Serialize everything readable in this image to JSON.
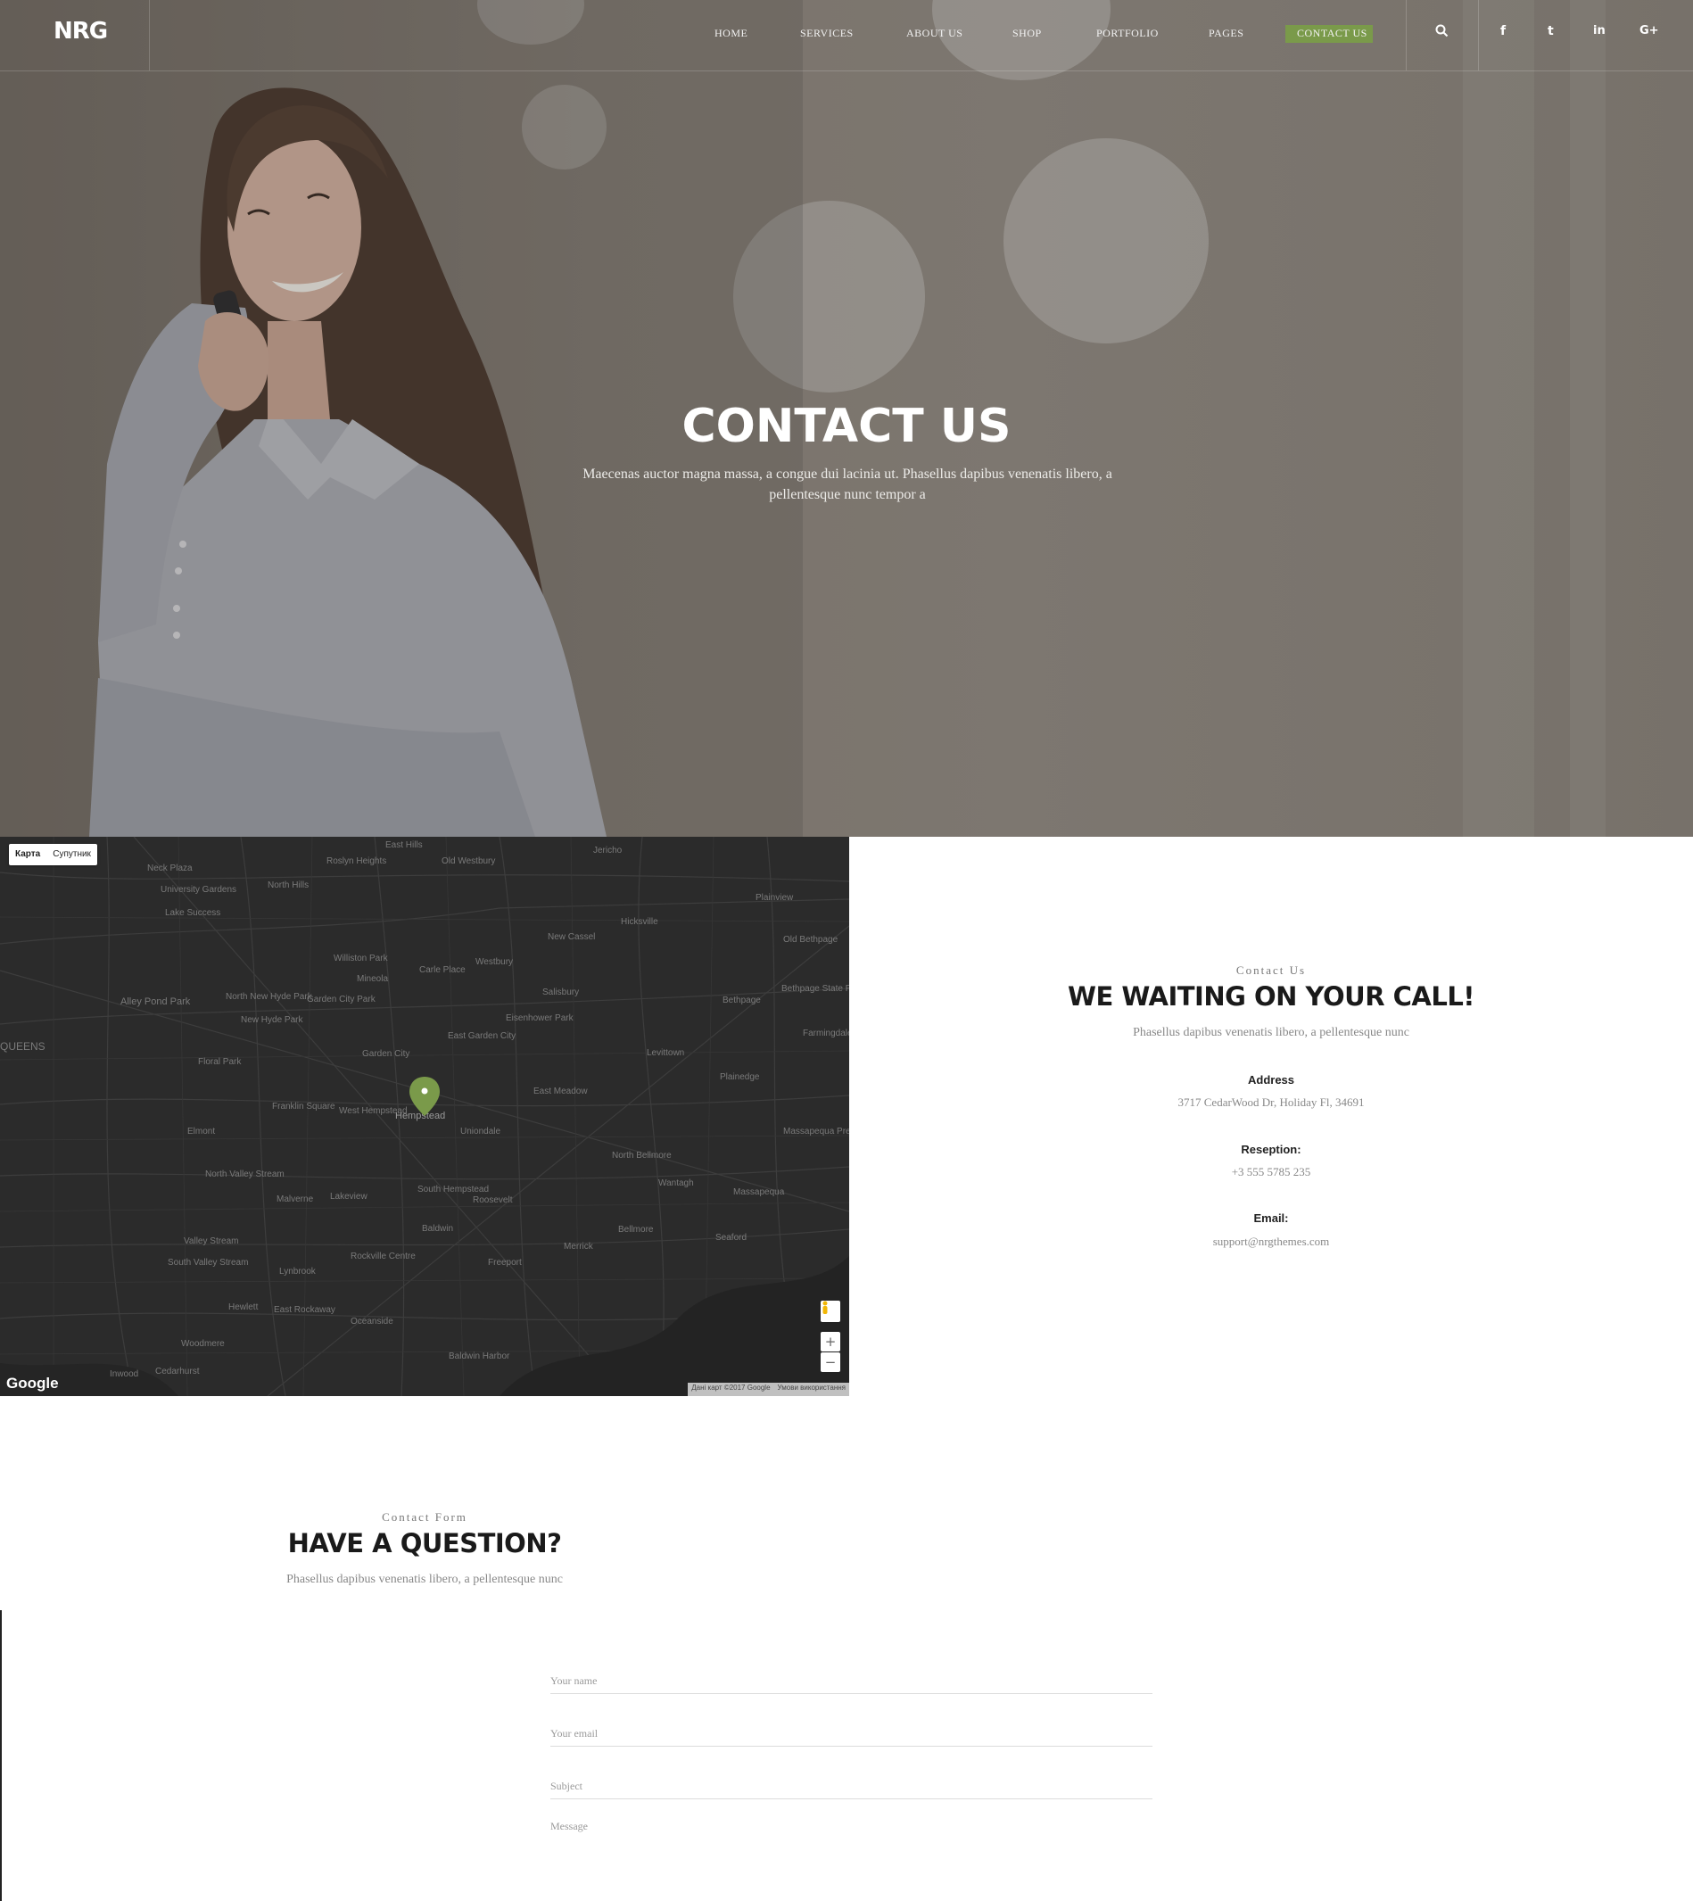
{
  "brand": {
    "logo": "NRG",
    "accent_color": "#7a9a4a"
  },
  "nav": {
    "items": [
      {
        "label": "HOME"
      },
      {
        "label": "SERVICES"
      },
      {
        "label": "ABOUT US"
      },
      {
        "label": "SHOP"
      },
      {
        "label": "PORTFOLIO"
      },
      {
        "label": "PAGES"
      },
      {
        "label": "CONTACT US",
        "active": true
      }
    ],
    "icons": [
      "search-icon",
      "facebook-icon",
      "twitter-icon",
      "linkedin-icon",
      "google-plus-icon"
    ],
    "icon_glyphs": {
      "search": "⌕",
      "facebook": "f",
      "twitter": "t",
      "linkedin": "in",
      "google_plus": "G+"
    }
  },
  "hero": {
    "title": "CONTACT US",
    "subtitle": "Maecenas auctor magna massa, a congue dui lacinia ut. Phasellus dapibus venenatis libero, a pellentesque nunc tempor a"
  },
  "map": {
    "type_buttons": [
      "Карта",
      "Супутник"
    ],
    "zoom_in": "+",
    "zoom_out": "−",
    "google_logo": "Google",
    "attribution": [
      "Дані карт ©2017 Google",
      "Умови використання"
    ],
    "labels": [
      "East Hills",
      "Jericho",
      "Roslyn Heights",
      "Old Westbury",
      "Great Neck Plaza",
      "University Gardens",
      "Lake Success",
      "North Hills",
      "Plainview",
      "Hicksville",
      "New Cassel",
      "Old Bethpage",
      "Williston Park",
      "Westbury",
      "Mineola",
      "Carle Place",
      "Salisbury",
      "Alley Pond Park",
      "North New Hyde Park",
      "Garden City Park",
      "New Hyde Park",
      "Eisenhower Park",
      "Bethpage",
      "Bethpage State Park",
      "East Garden City",
      "Garden City",
      "Floral Park",
      "Levittown",
      "Plainedge",
      "Hempstead",
      "East Meadow",
      "Franklin Square",
      "West Hempstead",
      "Elmont",
      "Uniondale",
      "Massapequa Preserve",
      "North Bellmore",
      "North Valley Stream",
      "Malverne",
      "Lakeview",
      "South Hempstead",
      "Roosevelt",
      "Wantagh",
      "Massapequa",
      "Valley Stream",
      "Baldwin",
      "Bellmore",
      "Merrick",
      "Seaford",
      "Lynbrook",
      "Rockville Centre",
      "South Valley Stream",
      "Freeport",
      "Hewlett",
      "East Rockaway",
      "Oceanside",
      "Woodmere",
      "Inwood",
      "Cedarhurst",
      "Baldwin Harbor",
      "QUEENS",
      "Farmingdale"
    ]
  },
  "contact": {
    "eyebrow": "Contact Us",
    "title": "WE WAITING ON YOUR CALL!",
    "subtitle": "Phasellus dapibus venenatis libero, a pellentesque nunc",
    "address_label": "Address",
    "address_value": "3717 CedarWood Dr, Holiday Fl, 34691",
    "reception_label": "Reseption:",
    "reception_value": "+3 555 5785 235",
    "email_label": "Email:",
    "email_value": "support@nrgthemes.com"
  },
  "form": {
    "eyebrow": "Contact Form",
    "title": "HAVE A QUESTION?",
    "subtitle": "Phasellus dapibus venenatis libero, a pellentesque nunc",
    "name_placeholder": "Your name",
    "email_placeholder": "Your email",
    "subject_placeholder": "Subject",
    "message_placeholder": "Message"
  }
}
